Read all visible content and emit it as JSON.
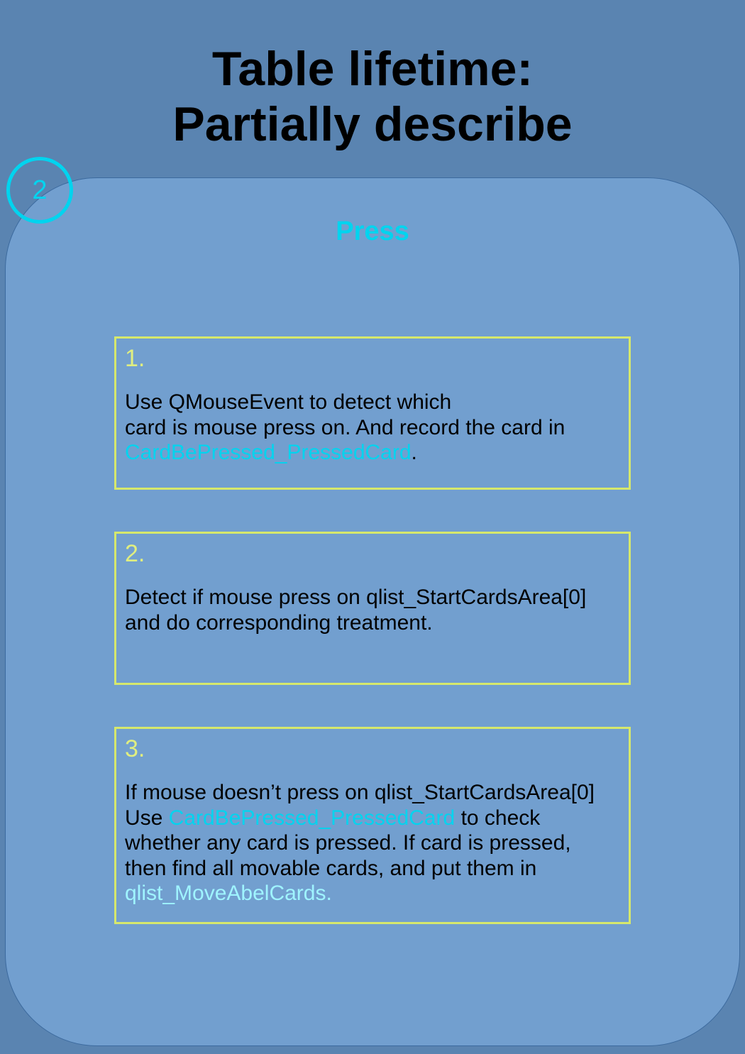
{
  "title": {
    "line1": "Table lifetime:",
    "line2": "Partially describe"
  },
  "step_badge": "2",
  "subtitle": "Press",
  "colors": {
    "background": "#5a84b1",
    "panel": "#729fcf",
    "accent": "#00d4ef",
    "box_border": "#d6e86c"
  },
  "steps": [
    {
      "number": "1.",
      "line1": "Use QMouseEvent to detect which",
      "line2": "card is mouse press on. And record the card in",
      "line3_highlight": "CardBePressed_PressedCard",
      "line3_tail": "."
    },
    {
      "number": "2.",
      "line1": "Detect if mouse press on qlist_StartCardsArea[0]",
      "line2": "and do corresponding treatment."
    },
    {
      "number": "3.",
      "line1": "If mouse doesn’t press on qlist_StartCardsArea[0]",
      "line2_head": "Use ",
      "line2_highlight": "CardBePressed_PressedCard",
      "line2_tail": " to check",
      "line3": "whether any card is pressed. If card is pressed,",
      "line4": "then find all movable cards, and put them in",
      "line5_highlight": "qlist_MoveAbelCards."
    }
  ]
}
